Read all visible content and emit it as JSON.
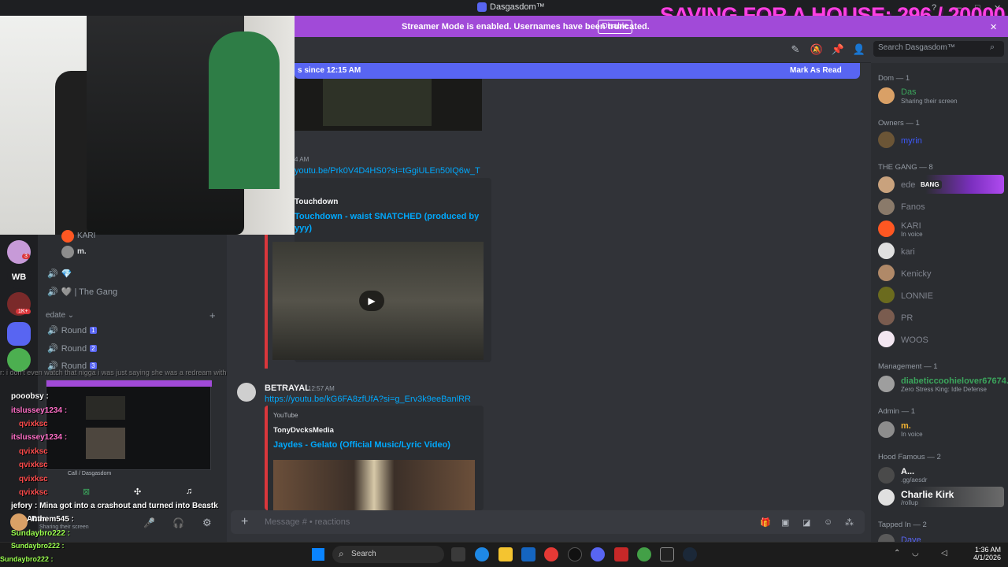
{
  "window": {
    "title": "Dasgasdom™",
    "overlay_goal": "SAVING FOR A HOUSE: 296 / 20000",
    "help": "?",
    "minimize": "—",
    "maximize": "□",
    "close": "✕",
    "banner_close": "✕"
  },
  "banner": {
    "text": "Streamer Mode is enabled. Usernames have been truncated.",
    "disable_label": "Disable"
  },
  "header": {
    "search_placeholder": "Search Dasgasdom™"
  },
  "new_bar": {
    "text": "s since 12:15 AM",
    "mark_read": "Mark As Read"
  },
  "messages": [
    {
      "time": "4 AM",
      "link": "youtu.be/Prk0V4D4HS0?si=tGgiULEn50IQ6w_T",
      "embed_author": "Touchdown",
      "embed_title_l1": "Touchdown - waist SNATCHED (produced by",
      "embed_title_l2": "yyy)"
    },
    {
      "author": "BETRAYAL",
      "time": "12:57 AM",
      "link": "https://youtu.be/kG6FA8zfUfA?si=g_Erv3k9eeBanlRR",
      "embed_provider": "YouTube",
      "embed_author": "TonyDvcksMedia",
      "embed_title": "Jaydes - Gelato (Official Music/Lyric Video)"
    }
  ],
  "input": {
    "placeholder": "Message #  •  reactions"
  },
  "members": {
    "groups": [
      {
        "title": "Dom — 1",
        "members": [
          {
            "name": "Das",
            "status": "Sharing their screen",
            "color": "#3ba55c"
          }
        ]
      },
      {
        "title": "Owners — 1",
        "members": [
          {
            "name": "myrin",
            "status": "",
            "color": "#3d5afe"
          }
        ]
      },
      {
        "title": "THE GANG — 8",
        "members": [
          {
            "name": "ede",
            "tag": "BANG",
            "status": "",
            "color": "#80848e"
          },
          {
            "name": "Fanos",
            "status": "",
            "color": "#80848e"
          },
          {
            "name": "KARI",
            "status": "In voice",
            "color": "#80848e"
          },
          {
            "name": "kari",
            "status": "",
            "color": "#80848e"
          },
          {
            "name": "Kenicky",
            "status": "",
            "color": "#80848e"
          },
          {
            "name": "LONNIE",
            "status": "",
            "color": "#80848e"
          },
          {
            "name": "PR",
            "status": "",
            "color": "#80848e"
          },
          {
            "name": "WOOS",
            "status": "",
            "color": "#80848e"
          }
        ]
      },
      {
        "title": "Management — 1",
        "members": [
          {
            "name": "diabeticcoohielover67674...",
            "status": "Zero Stress King: Idle Defense",
            "color": "#3ba55c"
          }
        ]
      },
      {
        "title": "Admin — 1",
        "members": [
          {
            "name": "m.",
            "status": "In voice",
            "color": "#f0b232"
          }
        ]
      },
      {
        "title": "Hood Famous — 2",
        "members": [
          {
            "name": "A...",
            "status": ".gg/aesdr",
            "color": "#ffffff"
          },
          {
            "name": "Charlie Kirk",
            "status": "/rollup",
            "color": "#ffffff"
          }
        ]
      },
      {
        "title": "Tapped In — 2",
        "members": [
          {
            "name": "Dave",
            "status": "",
            "color": "#5865f2"
          }
        ]
      }
    ]
  },
  "sidebar": {
    "voice_users": [
      "KARI",
      "m."
    ],
    "channels": [
      {
        "label": "💎",
        "badge": ""
      },
      {
        "label": "🩶 | The Gang",
        "badge": ""
      }
    ],
    "category": "edate",
    "rounds": [
      {
        "label": "Round",
        "badge": "1"
      },
      {
        "label": "Round",
        "badge": "2"
      },
      {
        "label": "Round",
        "badge": "3"
      }
    ],
    "servers": [
      {
        "label": "WB"
      },
      {
        "label": "1K+"
      }
    ],
    "mention_badge": "3",
    "call_label": "Call / Dasgasdom"
  },
  "chat": {
    "lines": [
      "r: i don't even watch that nigga i was just saying she was a redream with",
      "pooobsy :",
      "itslussey1234 :",
      "qvixksc",
      "itslussey1234 :",
      "qvixksc",
      "qvixksc",
      "qvixksc",
      "qvixksc",
      "jefory : Mina got into a crashout and turned into Beastk",
      "Anthem545 :",
      "Sundaybro222 :",
      "Sundaybro222 :",
      "Sundaybro222 :"
    ]
  },
  "user_panel": {
    "name": "Das",
    "status": "Sharing their screen"
  },
  "taskbar": {
    "search": "Search",
    "time": "1:36 AM",
    "date": "4/1/2026"
  }
}
